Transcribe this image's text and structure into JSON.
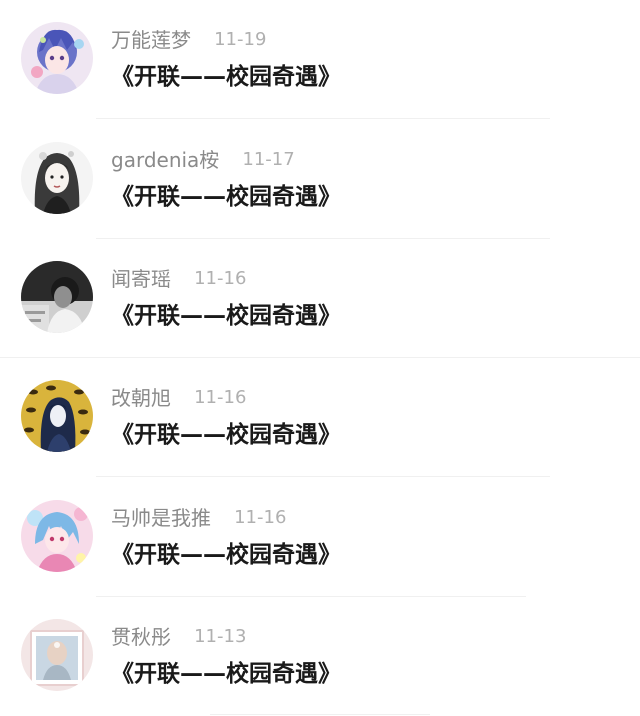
{
  "comments": [
    {
      "username": "万能莲梦",
      "date": "11-19",
      "message": "《开联——校园奇遇》",
      "avatar": "anime-girl-blue-hair-avatar"
    },
    {
      "username": "gardenia桉",
      "date": "11-17",
      "message": "《开联——校园奇遇》",
      "avatar": "sketch-girl-avatar"
    },
    {
      "username": "闻寄瑶",
      "date": "11-16",
      "message": "《开联——校园奇遇》",
      "avatar": "monochrome-man-avatar"
    },
    {
      "username": "改朝旭",
      "date": "11-16",
      "message": "《开联——校园奇遇》",
      "avatar": "eyes-pattern-girl-avatar"
    },
    {
      "username": "马帅是我推",
      "date": "11-16",
      "message": "《开联——校园奇遇》",
      "avatar": "pastel-anime-avatar"
    },
    {
      "username": "贯秋彤",
      "date": "11-13",
      "message": "《开联——校园奇遇》",
      "avatar": "framed-portrait-avatar"
    }
  ]
}
